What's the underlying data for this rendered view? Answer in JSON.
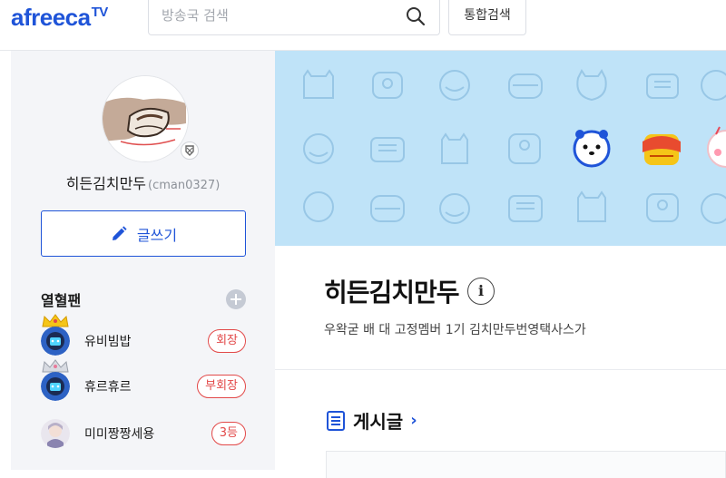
{
  "header": {
    "logo_text": "afreeca",
    "logo_sup": "TV",
    "search_placeholder": "방송국 검색",
    "search_value": "",
    "search_button_label": "통합검색"
  },
  "profile": {
    "name": "히든김치만두",
    "id": "(cman0327)",
    "write_button_label": "글쓰기"
  },
  "fans": {
    "title": "열혈팬",
    "items": [
      {
        "name": "유비빔밥",
        "rank": "회장",
        "crown": "gold"
      },
      {
        "name": "휴르휴르",
        "rank": "부회장",
        "crown": "silver"
      },
      {
        "name": "미미짱짱세용",
        "rank": "3등",
        "crown": "none"
      }
    ]
  },
  "channel": {
    "title": "히든김치만두",
    "info_icon_label": "i",
    "description": "우왁굳 배 대 고정멤버 1기 김치만두번영택사스가"
  },
  "board": {
    "title": "게시글",
    "arrow": "›"
  },
  "colors": {
    "brand": "#1f54d8",
    "banner": "#bfe3f8",
    "rank_red": "#e24848",
    "sidebar_bg": "#f4f5f8"
  }
}
